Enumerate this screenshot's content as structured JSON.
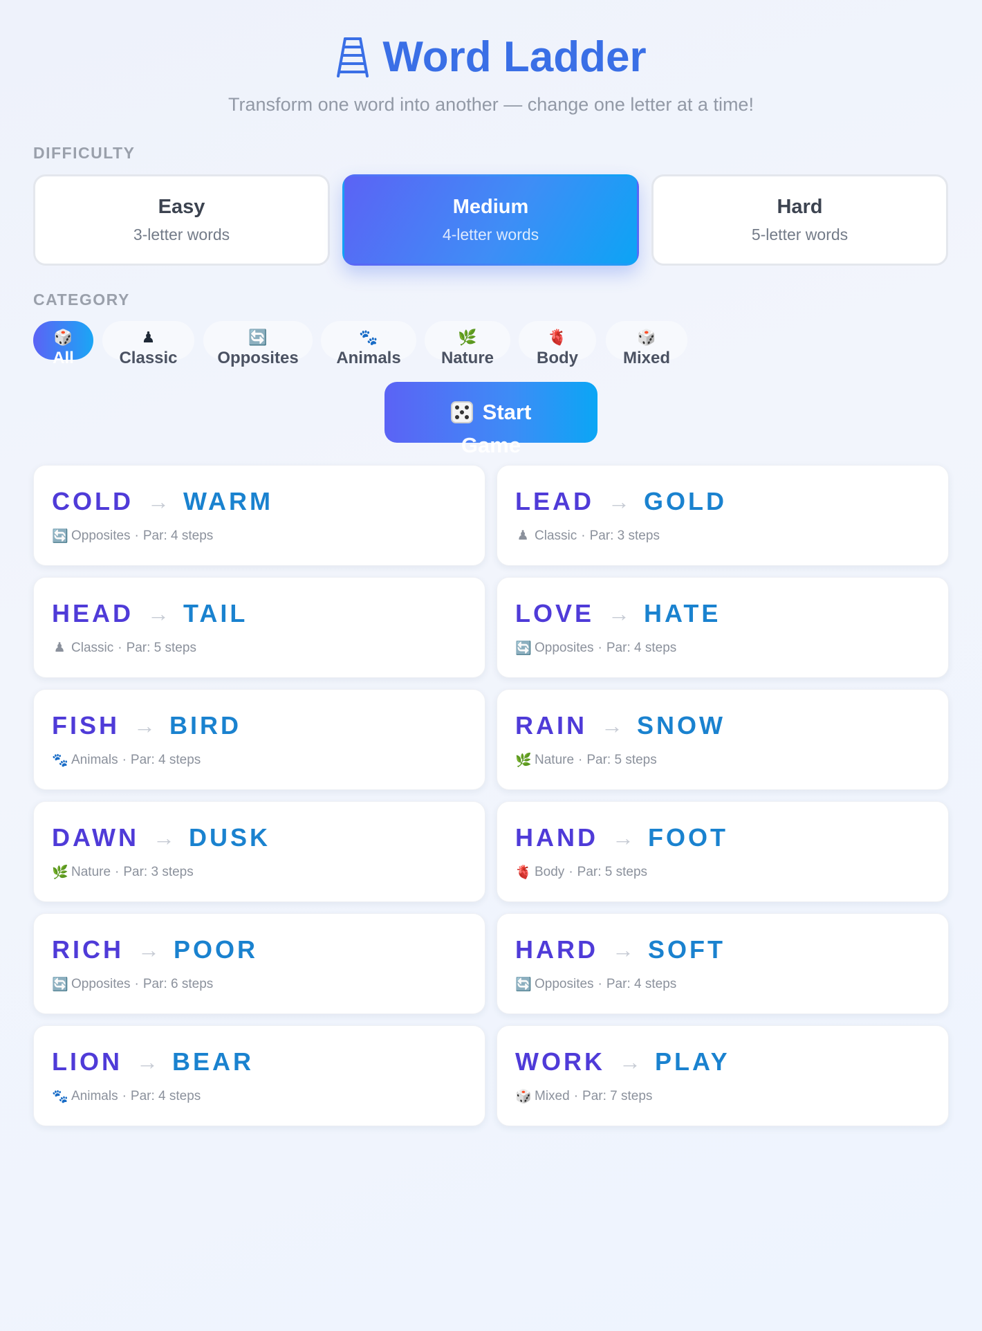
{
  "header": {
    "title": "Word Ladder",
    "icon": "ladder-icon",
    "subtitle": "Transform one word into another — change one letter at a time!",
    "accent_color": "#3a6fe6"
  },
  "difficulty": {
    "label": "DIFFICULTY",
    "options": [
      {
        "name": "Easy",
        "sub": "3-letter words",
        "active": false
      },
      {
        "name": "Medium",
        "sub": "4-letter words",
        "active": true
      },
      {
        "name": "Hard",
        "sub": "5-letter words",
        "active": false
      }
    ]
  },
  "category": {
    "label": "CATEGORY",
    "options": [
      {
        "label": "All",
        "icon": "🎲",
        "active": true
      },
      {
        "label": "Classic",
        "icon": "♟",
        "active": false
      },
      {
        "label": "Opposites",
        "icon": "🔄",
        "active": false
      },
      {
        "label": "Animals",
        "icon": "🐾",
        "active": false
      },
      {
        "label": "Nature",
        "icon": "🌿",
        "active": false
      },
      {
        "label": "Body",
        "icon": "🫀",
        "active": false
      },
      {
        "label": "Mixed",
        "icon": "🎲",
        "active": false
      }
    ]
  },
  "start": {
    "line1": "Start",
    "line2": "Game",
    "icon": "die-icon"
  },
  "puzzles": [
    {
      "from": "COLD",
      "to": "WARM",
      "icon": "🔄",
      "category": "Opposites",
      "par": "Par: 4 steps"
    },
    {
      "from": "LEAD",
      "to": "GOLD",
      "icon": "♟",
      "category": "Classic",
      "par": "Par: 3 steps"
    },
    {
      "from": "HEAD",
      "to": "TAIL",
      "icon": "♟",
      "category": "Classic",
      "par": "Par: 5 steps"
    },
    {
      "from": "LOVE",
      "to": "HATE",
      "icon": "🔄",
      "category": "Opposites",
      "par": "Par: 4 steps"
    },
    {
      "from": "FISH",
      "to": "BIRD",
      "icon": "🐾",
      "category": "Animals",
      "par": "Par: 4 steps"
    },
    {
      "from": "RAIN",
      "to": "SNOW",
      "icon": "🌿",
      "category": "Nature",
      "par": "Par: 5 steps"
    },
    {
      "from": "DAWN",
      "to": "DUSK",
      "icon": "🌿",
      "category": "Nature",
      "par": "Par: 3 steps"
    },
    {
      "from": "HAND",
      "to": "FOOT",
      "icon": "🫀",
      "category": "Body",
      "par": "Par: 5 steps"
    },
    {
      "from": "RICH",
      "to": "POOR",
      "icon": "🔄",
      "category": "Opposites",
      "par": "Par: 6 steps"
    },
    {
      "from": "HARD",
      "to": "SOFT",
      "icon": "🔄",
      "category": "Opposites",
      "par": "Par: 4 steps"
    },
    {
      "from": "LION",
      "to": "BEAR",
      "icon": "🐾",
      "category": "Animals",
      "par": "Par: 4 steps"
    },
    {
      "from": "WORK",
      "to": "PLAY",
      "icon": "🎲",
      "category": "Mixed",
      "par": "Par: 7 steps"
    }
  ],
  "separator": "·",
  "arrow": "→"
}
